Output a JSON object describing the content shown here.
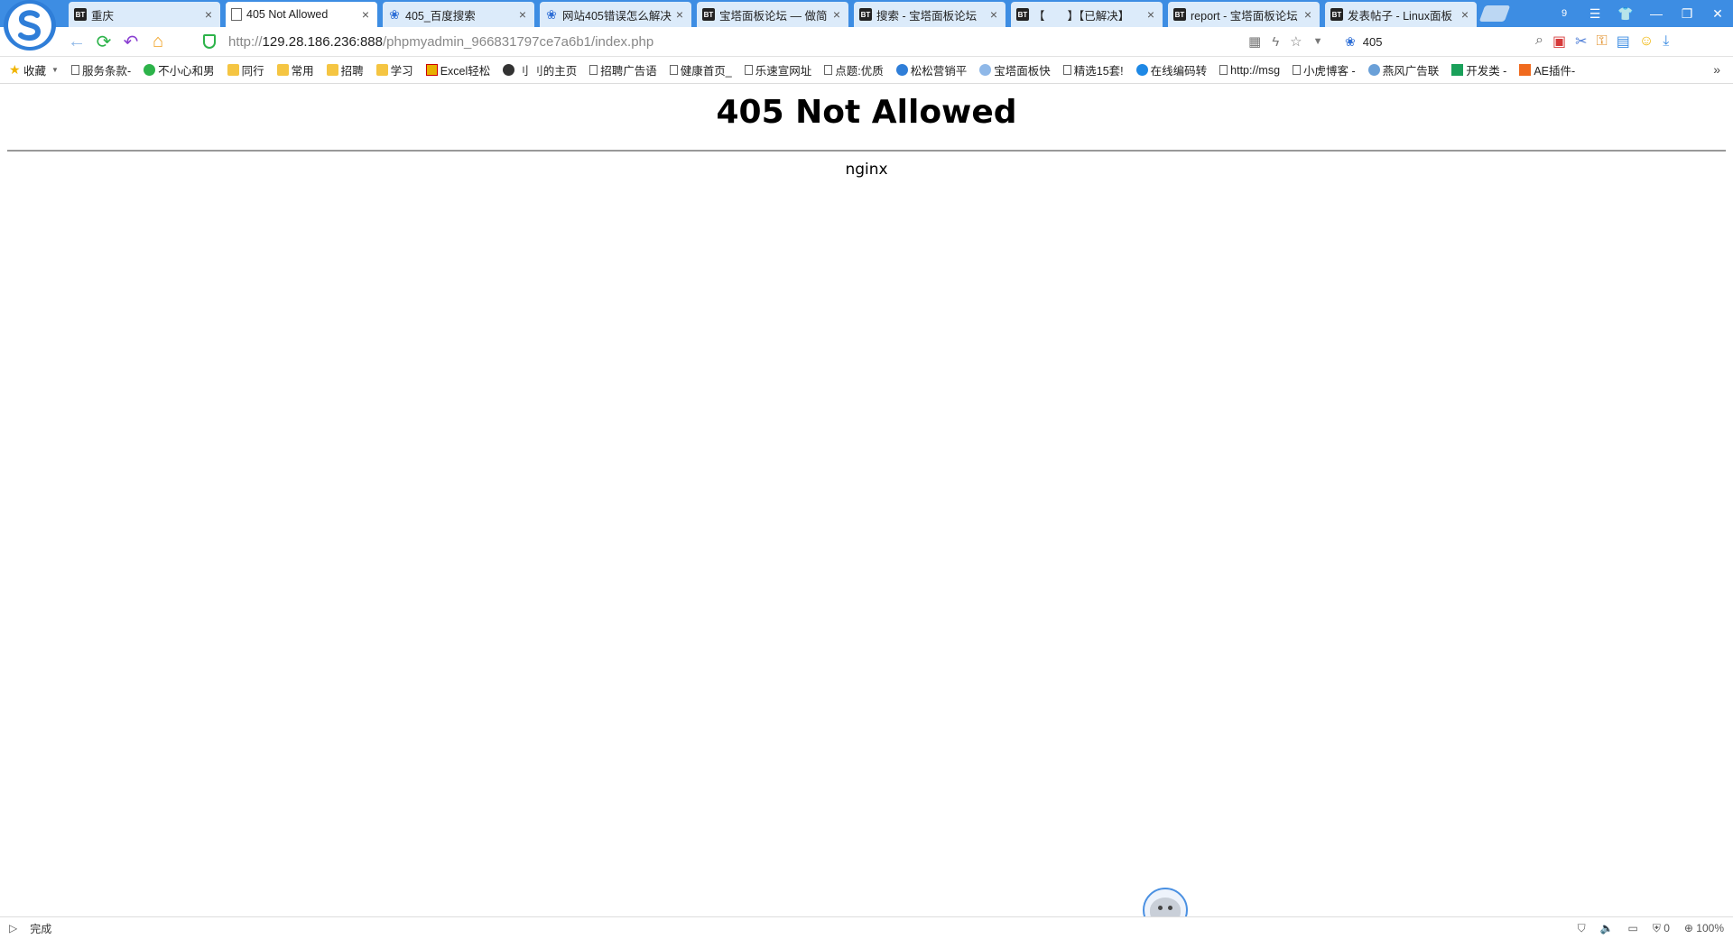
{
  "tabs": [
    {
      "label": "重庆",
      "icon": "bt-icon"
    },
    {
      "label": "405 Not Allowed",
      "icon": "page-icon",
      "active": true
    },
    {
      "label": "405_百度搜索",
      "icon": "baidu-paw-icon"
    },
    {
      "label": "网站405错误怎么解决",
      "icon": "baidu-paw-icon"
    },
    {
      "label": "宝塔面板论坛 — 做简",
      "icon": "bt-icon"
    },
    {
      "label": "搜索 - 宝塔面板论坛",
      "icon": "bt-icon"
    },
    {
      "label": "【　　】【已解决】",
      "icon": "bt-icon"
    },
    {
      "label": "report - 宝塔面板论坛",
      "icon": "bt-icon"
    },
    {
      "label": "发表帖子 - Linux面板",
      "icon": "bt-icon"
    }
  ],
  "address": {
    "scheme": "http://",
    "host": "129.28.186.236:888",
    "path": "/phpmyadmin_966831797ce7a6b1/index.php"
  },
  "search": {
    "query": "405"
  },
  "bookmarks": [
    {
      "label": "收藏",
      "icon": "star-icon"
    },
    {
      "label": "服务条款-",
      "icon": "page-icon"
    },
    {
      "label": "不小心和男",
      "icon": "wechat-icon"
    },
    {
      "label": "同行",
      "icon": "folder-icon"
    },
    {
      "label": "常用",
      "icon": "folder-icon"
    },
    {
      "label": "招聘",
      "icon": "folder-icon"
    },
    {
      "label": "学习",
      "icon": "folder-icon"
    },
    {
      "label": "Excel轻松",
      "icon": "excel-s-icon"
    },
    {
      "label": "刂 刂的主页",
      "icon": "site-icon"
    },
    {
      "label": "招聘广告语",
      "icon": "page-icon"
    },
    {
      "label": "健康首页_",
      "icon": "page-icon"
    },
    {
      "label": "乐速宣网址",
      "icon": "page-icon"
    },
    {
      "label": "点题:优质",
      "icon": "page-icon"
    },
    {
      "label": "松松营销平",
      "icon": "songsong-icon"
    },
    {
      "label": "宝塔面板快",
      "icon": "bt-site-icon"
    },
    {
      "label": "精选15套!",
      "icon": "page-icon"
    },
    {
      "label": "在线编码转",
      "icon": "encode-icon"
    },
    {
      "label": "http://msg",
      "icon": "page-icon"
    },
    {
      "label": "小虎博客 -",
      "icon": "page-icon"
    },
    {
      "label": "燕风广告联",
      "icon": "globe-icon"
    },
    {
      "label": "开发类 -",
      "icon": "t-icon"
    },
    {
      "label": "AE插件-",
      "icon": "plus-icon"
    }
  ],
  "page": {
    "heading": "405 Not Allowed",
    "server": "nginx"
  },
  "status": {
    "text": "完成",
    "count": "0",
    "zoom": "100%"
  },
  "window": {
    "badge": "9"
  }
}
